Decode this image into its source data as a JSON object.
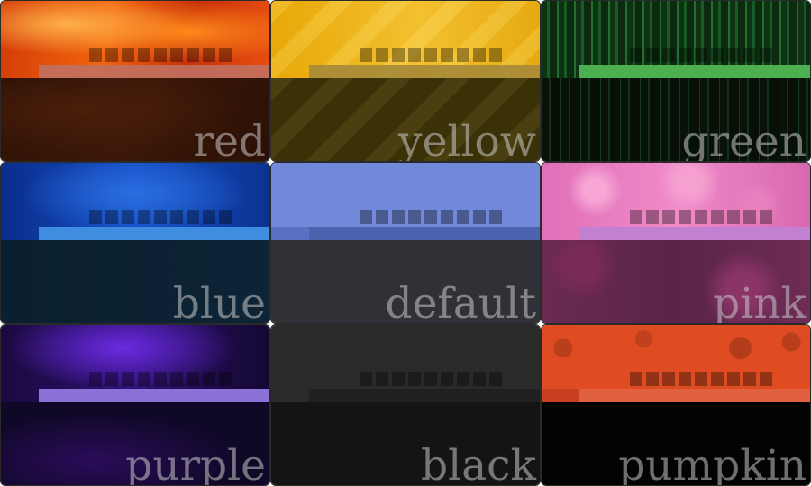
{
  "themes": [
    {
      "id": "red",
      "label": "red",
      "accent": "#c07060"
    },
    {
      "id": "yellow",
      "label": "yellow",
      "accent": "#a68a3a"
    },
    {
      "id": "green",
      "label": "green",
      "accent": "#4db050"
    },
    {
      "id": "blue",
      "label": "blue",
      "accent": "#3f8de0"
    },
    {
      "id": "default",
      "label": "default",
      "accent": "#7289da"
    },
    {
      "id": "pink",
      "label": "pink",
      "accent": "#c280d0"
    },
    {
      "id": "purple",
      "label": "purple",
      "accent": "#8a72d8"
    },
    {
      "id": "black",
      "label": "black",
      "accent": "#2a2a2a"
    },
    {
      "id": "pumpkin",
      "label": "pumpkin",
      "accent": "#e06040"
    }
  ]
}
